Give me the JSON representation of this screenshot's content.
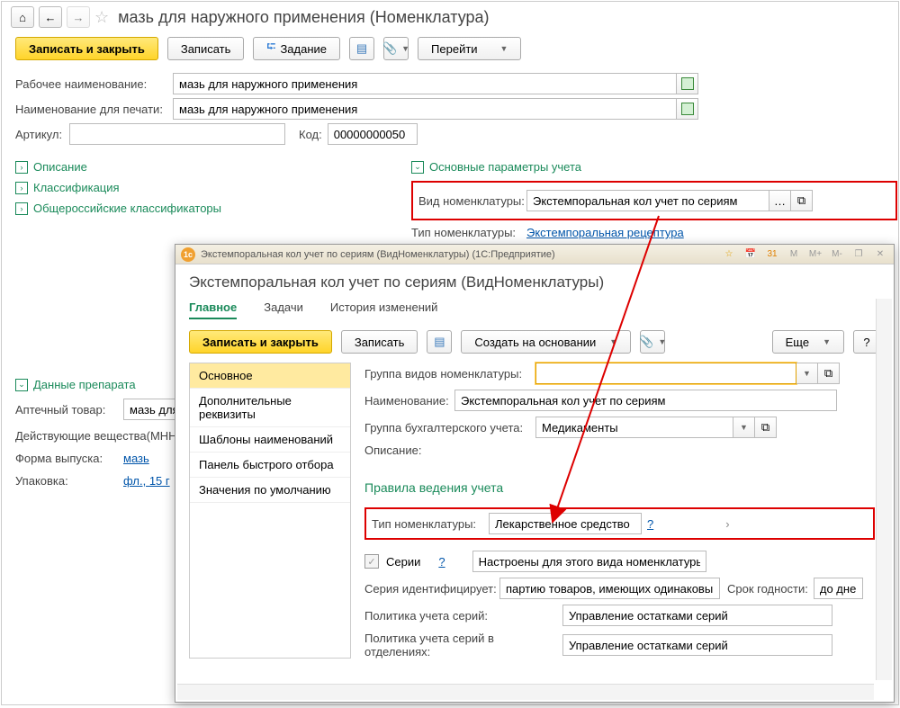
{
  "header": {
    "title": "мазь для наружного применения (Номенклатура)"
  },
  "toolbar_main": {
    "save_close": "Записать и закрыть",
    "save": "Записать",
    "task": "Задание",
    "go": "Перейти"
  },
  "fields": {
    "work_name_lbl": "Рабочее наименование:",
    "work_name": "мазь для наружного применения",
    "print_name_lbl": "Наименование для печати:",
    "print_name": "мазь для наружного применения",
    "article_lbl": "Артикул:",
    "article": "",
    "code_lbl": "Код:",
    "code": "00000000050"
  },
  "sections": {
    "description": "Описание",
    "classification": "Классификация",
    "all_russian": "Общероссийские классификаторы",
    "main_params": "Основные параметры учета",
    "drug_data": "Данные препарата"
  },
  "right": {
    "kind_lbl": "Вид номенклатуры:",
    "kind_val": "Экстемпоральная кол учет по сериям",
    "type_lbl": "Тип номенклатуры:",
    "type_val": "Экстемпоральная рецептура"
  },
  "drug": {
    "pharmacy_item_lbl": "Аптечный товар:",
    "pharmacy_item_val": "мазь для на",
    "active_sub_lbl": "Действующие вещества(МНН)",
    "release_form_lbl": "Форма выпуска:",
    "release_form_val": "мазь",
    "pack_lbl": "Упаковка:",
    "pack_val": "фл., 15 г"
  },
  "dialog": {
    "titlebar": "Экстемпоральная кол учет по сериям (ВидНоменклатуры)  (1С:Предприятие)",
    "h1": "Экстемпоральная кол учет по сериям (ВидНоменклатуры)",
    "tabs": {
      "main": "Главное",
      "tasks": "Задачи",
      "history": "История изменений"
    },
    "tb": {
      "save_close": "Записать и закрыть",
      "save": "Записать",
      "create_on": "Создать на основании",
      "more": "Еще",
      "help": "?"
    },
    "side": {
      "main": "Основное",
      "extra": "Дополнительные реквизиты",
      "templates": "Шаблоны наименований",
      "quick": "Панель быстрого отбора",
      "defaults": "Значения по умолчанию"
    },
    "f": {
      "group_kinds_lbl": "Группа видов номенклатуры:",
      "group_kinds_val": "",
      "name_lbl": "Наименование:",
      "name_val": "Экстемпоральная кол учет по сериям",
      "accounting_group_lbl": "Группа бухгалтерского учета:",
      "accounting_group_val": "Медикаменты",
      "description_lbl": "Описание:"
    },
    "rules": {
      "title": "Правила ведения учета",
      "type_lbl": "Тип номенклатуры:",
      "type_val": "Лекарственное средство",
      "help": "?",
      "series_lbl": "Серии",
      "series_setup": "Настроены для этого вида номенклатуры",
      "series_identify_lbl": "Серия идентифицирует:",
      "series_identify_val": "партию товаров, имеющих одинаковый ном",
      "expiry_lbl": "Срок годности:",
      "expiry_val": "до дней",
      "policy_lbl": "Политика учета серий:",
      "policy_val": "Управление остатками серий",
      "policy_dept_lbl": "Политика учета серий в отделениях:",
      "policy_dept_val": "Управление остатками серий"
    },
    "wintools": {
      "m": "M",
      "mp": "M+",
      "mm": "M-"
    }
  }
}
